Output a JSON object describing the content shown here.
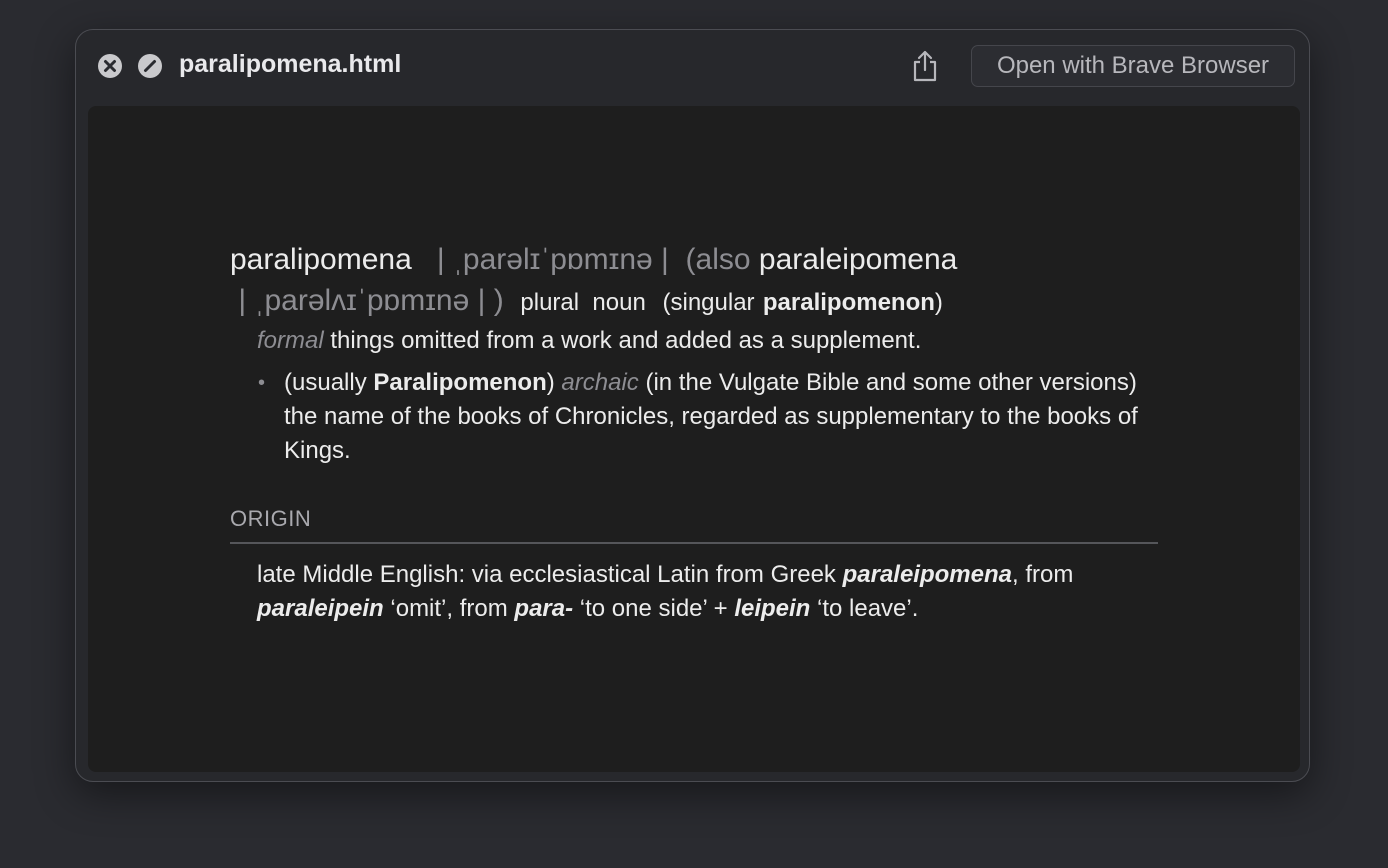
{
  "window": {
    "title": "paralipomena.html",
    "open_button_label": "Open with Brave Browser",
    "icons": {
      "close": "close-circle-icon",
      "stop": "stop-circle-icon",
      "share": "share-icon"
    }
  },
  "entry": {
    "headword": "paralipomena",
    "pronunciation": "| ˌparəlɪˈpɒmɪnə |",
    "also_open": "(also",
    "variant": "paraleipomena",
    "variant_pronunciation": "| ˌparəlʌɪˈpɒmɪnə |",
    "also_close": ")",
    "pos": "plural  noun",
    "singular_open": "(singular",
    "singular": "paralipomenon",
    "singular_close": ")",
    "sense1": {
      "label": "formal",
      "text": "things omitted from a work and added as a supplement."
    },
    "sense2": {
      "bullet": "•",
      "prefix": "(usually",
      "proper": "Paralipomenon",
      "close": ")",
      "label": "archaic",
      "text": "(in the Vulgate Bible and some other versions) the name of the books of Chronicles, regarded as supplementary to the books of Kings."
    },
    "origin": {
      "heading": "ORIGIN",
      "t1": "late Middle English: via ecclesiastical Latin from Greek ",
      "w1": "paraleipomena",
      "t2": ", from ",
      "w2": "paraleipein",
      "t3": " ‘omit’, from ",
      "w3": "para-",
      "t4": " ‘to one side’ + ",
      "w4": "leipein",
      "t5": " ‘to leave’."
    }
  }
}
